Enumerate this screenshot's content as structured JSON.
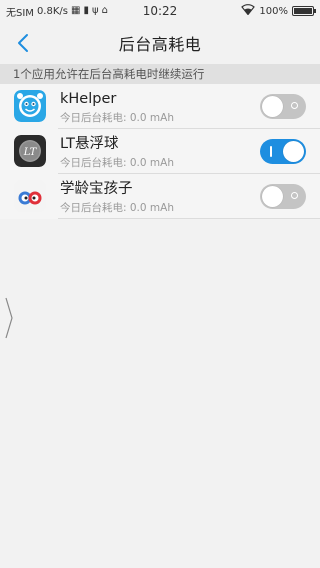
{
  "status_bar": {
    "carrier": "无SIM",
    "speed": "0.8K/s",
    "time": "10:22",
    "battery": "100%"
  },
  "header": {
    "title": "后台高耗电"
  },
  "section": {
    "title": "1个应用允许在后台高耗电时继续运行"
  },
  "apps": [
    {
      "name": "kHelper",
      "usage": "今日后台耗电: 0.0 mAh",
      "enabled": false,
      "icon": "khelper-icon"
    },
    {
      "name": "LT悬浮球",
      "usage": "今日后台耗电: 0.0 mAh",
      "enabled": true,
      "icon": "lt-floating-ball-icon"
    },
    {
      "name": "学龄宝孩子",
      "usage": "今日后台耗电: 0.0 mAh",
      "enabled": false,
      "icon": "xuelingbao-icon"
    }
  ],
  "colors": {
    "accent": "#1e8ee0",
    "toggle_off": "#c4c4c4",
    "background": "#f2f2f2",
    "section_bg": "#e0e0e0"
  }
}
